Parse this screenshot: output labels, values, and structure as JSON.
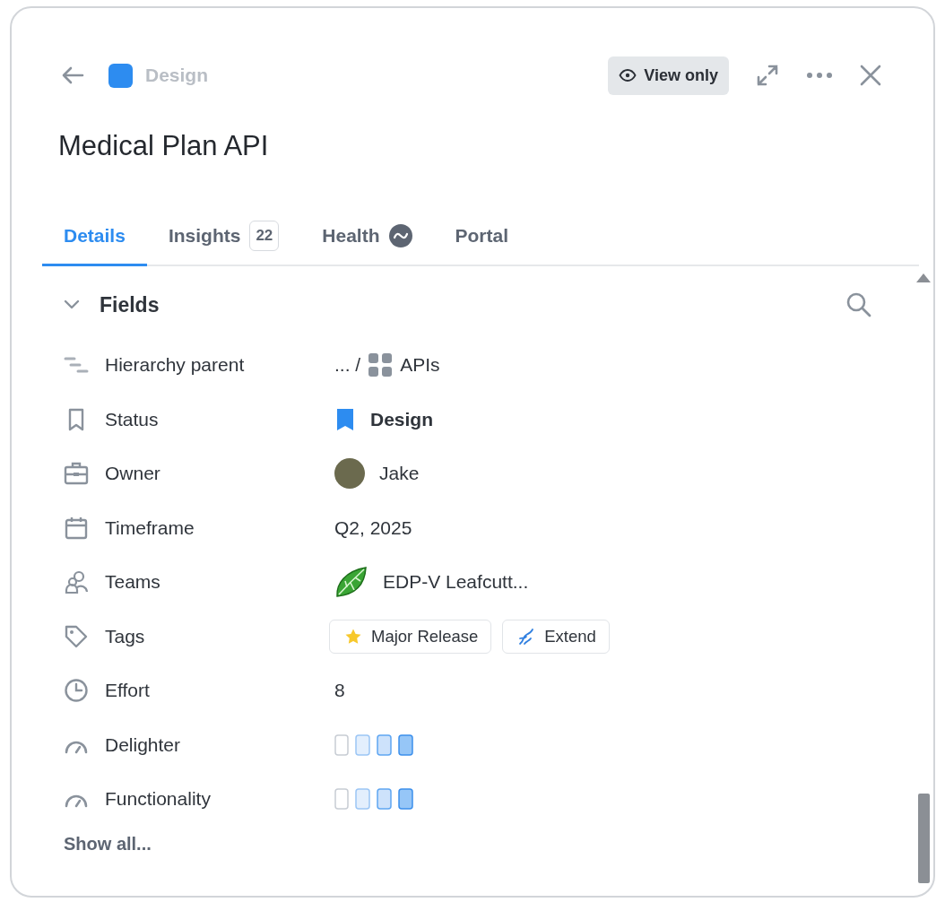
{
  "header": {
    "breadcrumb": "Design",
    "view_mode": "View only"
  },
  "title": "Medical Plan API",
  "tabs": [
    {
      "label": "Details",
      "kind": "plain",
      "selected": true
    },
    {
      "label": "Insights",
      "kind": "count",
      "count": "22",
      "selected": false
    },
    {
      "label": "Health",
      "kind": "icon",
      "selected": false
    },
    {
      "label": "Portal",
      "kind": "plain",
      "selected": false
    }
  ],
  "section": {
    "title": "Fields",
    "expanded": true
  },
  "fields": [
    {
      "label": "Hierarchy parent",
      "kind": "hierarchy",
      "prefix": "... /",
      "value": "APIs"
    },
    {
      "label": "Status",
      "kind": "status",
      "value": "Design"
    },
    {
      "label": "Owner",
      "kind": "person",
      "value": "Jake"
    },
    {
      "label": "Timeframe",
      "kind": "text",
      "value": "Q2, 2025"
    },
    {
      "label": "Teams",
      "kind": "team",
      "value": "EDP-V Leafcutt..."
    },
    {
      "label": "Tags",
      "kind": "tags",
      "tags": [
        {
          "label": "Major Release",
          "kind": "star"
        },
        {
          "label": "Extend",
          "kind": "helix"
        }
      ]
    },
    {
      "label": "Effort",
      "kind": "text",
      "value": "8"
    },
    {
      "label": "Delighter",
      "kind": "scale"
    },
    {
      "label": "Functionality",
      "kind": "scale"
    }
  ],
  "show_all": "Show all..."
}
